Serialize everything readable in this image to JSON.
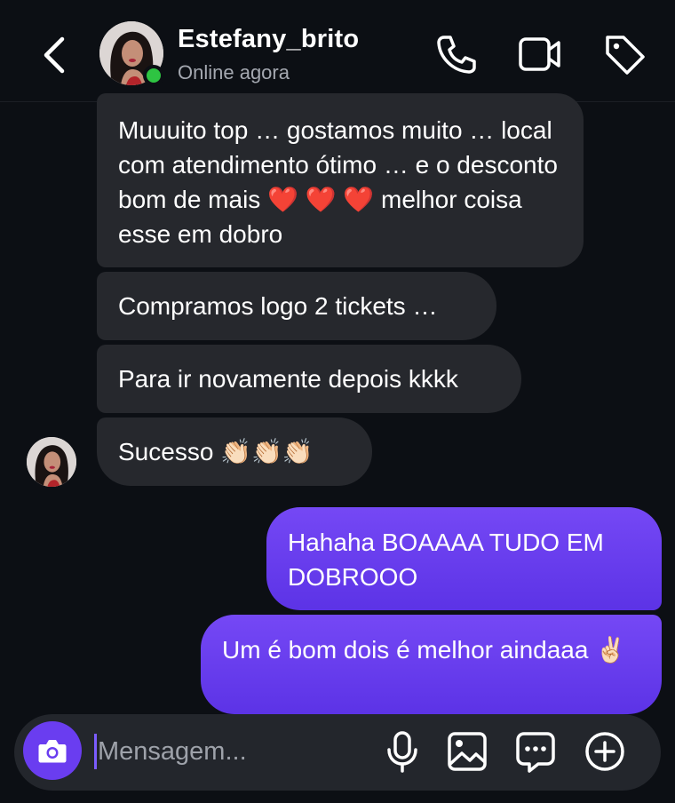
{
  "header": {
    "username": "Estefany_brito",
    "status": "Online agora"
  },
  "messages": [
    {
      "direction": "incoming",
      "text": "Muuuito top … gostamos muito … local com atendimento ótimo … e o desconto bom de mais ❤️ ❤️ ❤️ melhor coisa esse em dobro"
    },
    {
      "direction": "incoming",
      "text": "Compramos logo 2 tickets …"
    },
    {
      "direction": "incoming",
      "text": "Para ir novamente depois kkkk"
    },
    {
      "direction": "incoming",
      "text": "Sucesso 👏🏻👏🏻👏🏻"
    },
    {
      "direction": "outgoing",
      "text": "Hahaha BOAAAA TUDO EM DOBROOO"
    },
    {
      "direction": "outgoing",
      "text": "Um é bom dois é melhor aindaaa ✌🏻"
    }
  ],
  "composer": {
    "placeholder": "Mensagem..."
  },
  "icons": {
    "back": "chevron-left-icon",
    "call": "phone-icon",
    "video": "video-camera-icon",
    "tag": "tag-icon",
    "camera": "camera-icon",
    "mic": "microphone-icon",
    "gallery": "image-icon",
    "sticker": "chat-bubble-icon",
    "more": "plus-circle-icon"
  },
  "colors": {
    "background": "#0c0f14",
    "incoming_bubble": "#26282d",
    "outgoing_bubble": "#6a3df0",
    "online": "#2ec442",
    "accent": "#6a3df0"
  }
}
